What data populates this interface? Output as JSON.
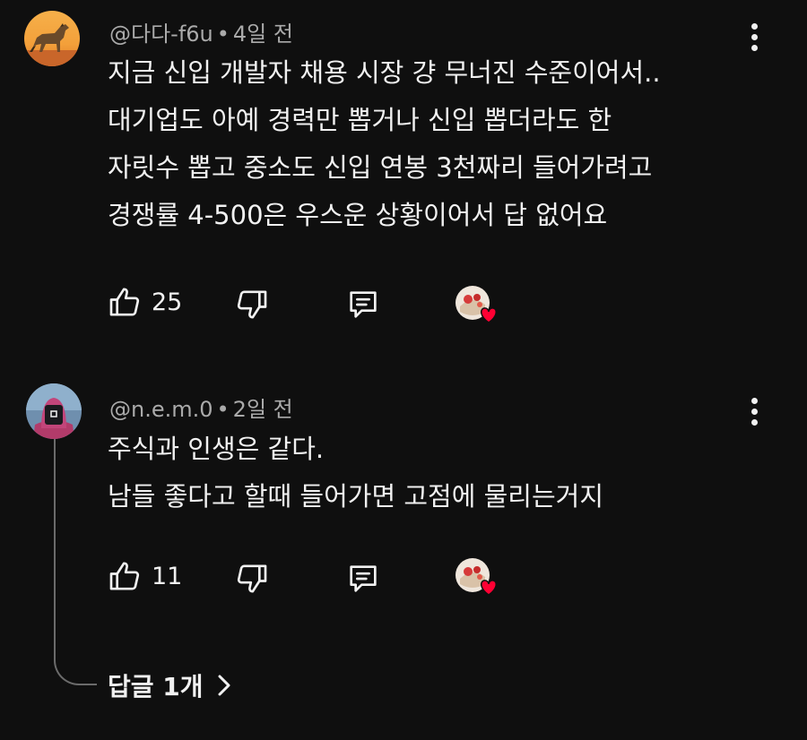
{
  "comments": [
    {
      "author": "@다다-f6u",
      "time": "4일 전",
      "lines": [
        "지금 신입 개발자 채용 시장 걍 무너진 수준이어서..",
        "대기업도 아예 경력만 뽑거나 신입 뽑더라도 한",
        "자릿수 뽑고 중소도 신입 연봉 3천짜리 들어가려고",
        "경쟁률 4-500은 우스운 상황이어서 답 없어요"
      ],
      "likes": "25",
      "avatar_icon": "horse-avatar-icon"
    },
    {
      "author": "@n.e.m.0",
      "time": "2일 전",
      "lines": [
        "주식과 인생은 같다.",
        "남들 좋다고 할때 들어가면 고점에 물리는거지"
      ],
      "likes": "11",
      "avatar_icon": "masked-guard-avatar-icon"
    }
  ],
  "separator": "•",
  "replies_label": "답글 1개",
  "colors": {
    "background": "#0f0f0f",
    "text": "#f1f1f1",
    "meta": "#aaaaaa",
    "heart": "#ff0033"
  }
}
